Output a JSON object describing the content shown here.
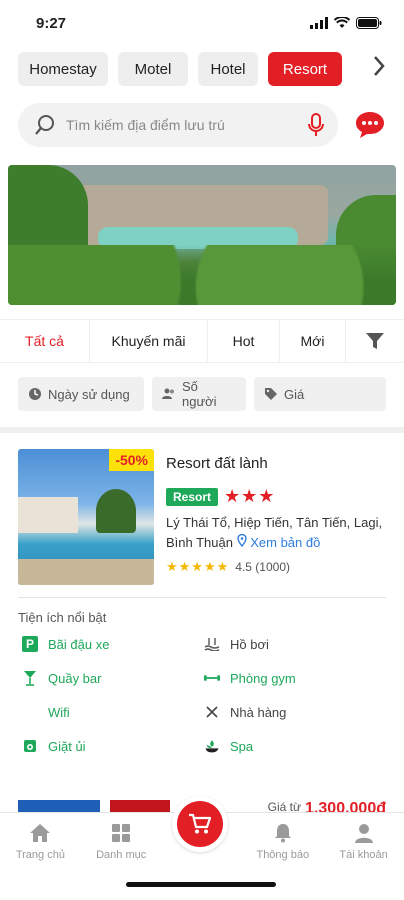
{
  "status": {
    "time": "9:27"
  },
  "categories": [
    "Homestay",
    "Motel",
    "Hotel",
    "Resort"
  ],
  "active_category": "Resort",
  "search": {
    "placeholder": "Tìm kiếm địa điểm lưu trú"
  },
  "tabs": [
    "Tất cả",
    "Khuyến mãi",
    "Hot",
    "Mới"
  ],
  "filters": [
    "Ngày sử dụng",
    "Số người",
    "Giá"
  ],
  "listing": {
    "discount": "-50%",
    "name": "Resort đất lành",
    "type_badge": "Resort",
    "class_stars": "★★★",
    "address": "Lý  Thái Tổ, Hiệp Tiến, Tân Tiến, Lagi, Bình Thuận",
    "map_link": "Xem bản đồ",
    "rating_stars": "★★★★★",
    "rating_text": "4.5 (1000)",
    "facilities_title": "Tiện ích nổi bật",
    "facilities": [
      {
        "label": "Bãi đậu xe",
        "icon": "parking-icon",
        "color": "green"
      },
      {
        "label": "Hồ bơi",
        "icon": "pool-icon",
        "color": "gray"
      },
      {
        "label": "Quầy bar",
        "icon": "cocktail-icon",
        "color": "green"
      },
      {
        "label": "Phòng gym",
        "icon": "dumbbell-icon",
        "color": "green"
      },
      {
        "label": "Wifi",
        "icon": "wifi-icon",
        "color": "green"
      },
      {
        "label": "Nhà hàng",
        "icon": "restaurant-icon",
        "color": "gray"
      },
      {
        "label": "Giặt ủi",
        "icon": "laundry-icon",
        "color": "green"
      },
      {
        "label": "Spa",
        "icon": "spa-icon",
        "color": "green"
      }
    ],
    "price_from": "Giá từ",
    "price_value": "1.300.000đ"
  },
  "nav": [
    "Trang chủ",
    "Danh mục",
    "Thông báo",
    "Tài khoản"
  ],
  "colors": {
    "accent": "#e31f26",
    "green": "#1ea85a",
    "link": "#2e7de0"
  }
}
